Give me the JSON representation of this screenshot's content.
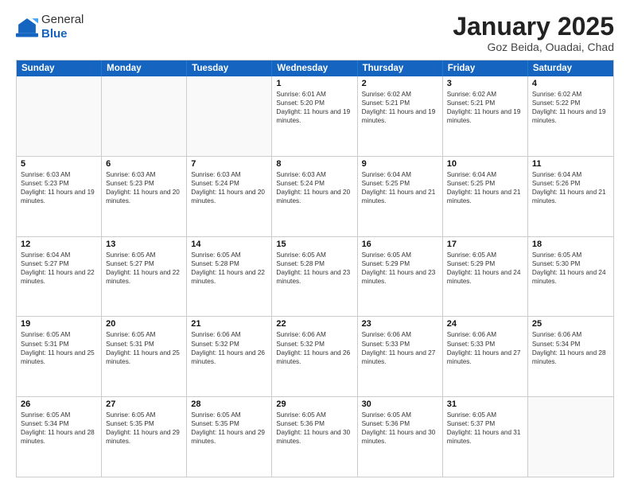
{
  "header": {
    "logo_general": "General",
    "logo_blue": "Blue",
    "month_title": "January 2025",
    "subtitle": "Goz Beida, Ouadai, Chad"
  },
  "days_of_week": [
    "Sunday",
    "Monday",
    "Tuesday",
    "Wednesday",
    "Thursday",
    "Friday",
    "Saturday"
  ],
  "weeks": [
    [
      {
        "day": "",
        "empty": true
      },
      {
        "day": "",
        "empty": true
      },
      {
        "day": "",
        "empty": true
      },
      {
        "day": "1",
        "sunrise": "6:01 AM",
        "sunset": "5:20 PM",
        "daylight": "11 hours and 19 minutes."
      },
      {
        "day": "2",
        "sunrise": "6:02 AM",
        "sunset": "5:21 PM",
        "daylight": "11 hours and 19 minutes."
      },
      {
        "day": "3",
        "sunrise": "6:02 AM",
        "sunset": "5:21 PM",
        "daylight": "11 hours and 19 minutes."
      },
      {
        "day": "4",
        "sunrise": "6:02 AM",
        "sunset": "5:22 PM",
        "daylight": "11 hours and 19 minutes."
      }
    ],
    [
      {
        "day": "5",
        "sunrise": "6:03 AM",
        "sunset": "5:23 PM",
        "daylight": "11 hours and 19 minutes."
      },
      {
        "day": "6",
        "sunrise": "6:03 AM",
        "sunset": "5:23 PM",
        "daylight": "11 hours and 20 minutes."
      },
      {
        "day": "7",
        "sunrise": "6:03 AM",
        "sunset": "5:24 PM",
        "daylight": "11 hours and 20 minutes."
      },
      {
        "day": "8",
        "sunrise": "6:03 AM",
        "sunset": "5:24 PM",
        "daylight": "11 hours and 20 minutes."
      },
      {
        "day": "9",
        "sunrise": "6:04 AM",
        "sunset": "5:25 PM",
        "daylight": "11 hours and 21 minutes."
      },
      {
        "day": "10",
        "sunrise": "6:04 AM",
        "sunset": "5:25 PM",
        "daylight": "11 hours and 21 minutes."
      },
      {
        "day": "11",
        "sunrise": "6:04 AM",
        "sunset": "5:26 PM",
        "daylight": "11 hours and 21 minutes."
      }
    ],
    [
      {
        "day": "12",
        "sunrise": "6:04 AM",
        "sunset": "5:27 PM",
        "daylight": "11 hours and 22 minutes."
      },
      {
        "day": "13",
        "sunrise": "6:05 AM",
        "sunset": "5:27 PM",
        "daylight": "11 hours and 22 minutes."
      },
      {
        "day": "14",
        "sunrise": "6:05 AM",
        "sunset": "5:28 PM",
        "daylight": "11 hours and 22 minutes."
      },
      {
        "day": "15",
        "sunrise": "6:05 AM",
        "sunset": "5:28 PM",
        "daylight": "11 hours and 23 minutes."
      },
      {
        "day": "16",
        "sunrise": "6:05 AM",
        "sunset": "5:29 PM",
        "daylight": "11 hours and 23 minutes."
      },
      {
        "day": "17",
        "sunrise": "6:05 AM",
        "sunset": "5:29 PM",
        "daylight": "11 hours and 24 minutes."
      },
      {
        "day": "18",
        "sunrise": "6:05 AM",
        "sunset": "5:30 PM",
        "daylight": "11 hours and 24 minutes."
      }
    ],
    [
      {
        "day": "19",
        "sunrise": "6:05 AM",
        "sunset": "5:31 PM",
        "daylight": "11 hours and 25 minutes."
      },
      {
        "day": "20",
        "sunrise": "6:05 AM",
        "sunset": "5:31 PM",
        "daylight": "11 hours and 25 minutes."
      },
      {
        "day": "21",
        "sunrise": "6:06 AM",
        "sunset": "5:32 PM",
        "daylight": "11 hours and 26 minutes."
      },
      {
        "day": "22",
        "sunrise": "6:06 AM",
        "sunset": "5:32 PM",
        "daylight": "11 hours and 26 minutes."
      },
      {
        "day": "23",
        "sunrise": "6:06 AM",
        "sunset": "5:33 PM",
        "daylight": "11 hours and 27 minutes."
      },
      {
        "day": "24",
        "sunrise": "6:06 AM",
        "sunset": "5:33 PM",
        "daylight": "11 hours and 27 minutes."
      },
      {
        "day": "25",
        "sunrise": "6:06 AM",
        "sunset": "5:34 PM",
        "daylight": "11 hours and 28 minutes."
      }
    ],
    [
      {
        "day": "26",
        "sunrise": "6:05 AM",
        "sunset": "5:34 PM",
        "daylight": "11 hours and 28 minutes."
      },
      {
        "day": "27",
        "sunrise": "6:05 AM",
        "sunset": "5:35 PM",
        "daylight": "11 hours and 29 minutes."
      },
      {
        "day": "28",
        "sunrise": "6:05 AM",
        "sunset": "5:35 PM",
        "daylight": "11 hours and 29 minutes."
      },
      {
        "day": "29",
        "sunrise": "6:05 AM",
        "sunset": "5:36 PM",
        "daylight": "11 hours and 30 minutes."
      },
      {
        "day": "30",
        "sunrise": "6:05 AM",
        "sunset": "5:36 PM",
        "daylight": "11 hours and 30 minutes."
      },
      {
        "day": "31",
        "sunrise": "6:05 AM",
        "sunset": "5:37 PM",
        "daylight": "11 hours and 31 minutes."
      },
      {
        "day": "",
        "empty": true
      }
    ]
  ]
}
